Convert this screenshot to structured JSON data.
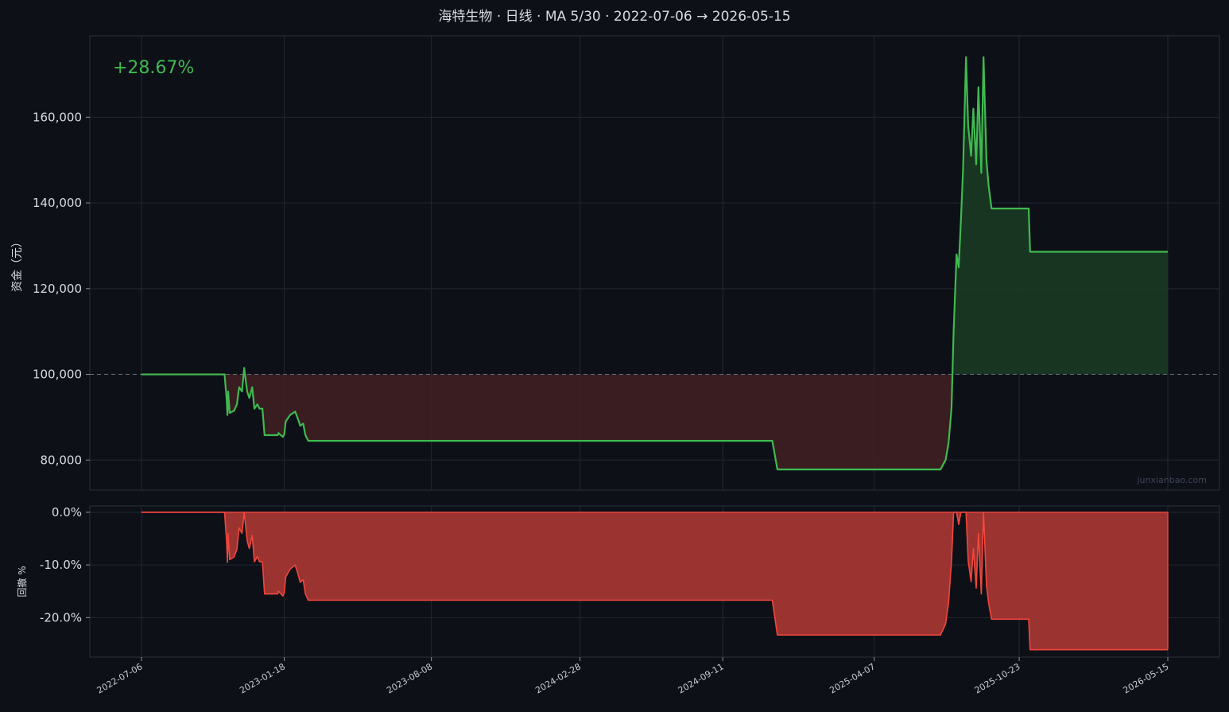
{
  "title": "海特生物 · 日线 · MA 5/30 · 2022-07-06 → 2026-05-15",
  "return_label": "+28.67%",
  "watermark": "junxianbao.com",
  "colors": {
    "background": "#0d1017",
    "equity_line": "#3fb950",
    "gain_fill": "#1a3a22",
    "loss_fill": "#3e1f22",
    "drawdown_line": "#f0473c",
    "drawdown_fill": "#9b3331",
    "return_text": "#3fb950"
  },
  "chart_data": [
    {
      "type": "area",
      "name": "equity",
      "ylabel": "资金（元）",
      "xlabel": "",
      "baseline": 100000,
      "ylim": [
        73000,
        179000
      ],
      "yticks": [
        80000,
        100000,
        120000,
        140000,
        160000
      ],
      "ytick_labels": [
        "80,000",
        "100,000",
        "120,000",
        "140,000",
        "160,000"
      ],
      "grid": true,
      "x": [
        "2022-07-06",
        "2022-10-28",
        "2022-10-31",
        "2022-11-01",
        "2022-11-02",
        "2022-11-04",
        "2022-11-10",
        "2022-11-14",
        "2022-11-17",
        "2022-11-21",
        "2022-11-24",
        "2022-11-28",
        "2022-12-01",
        "2022-12-05",
        "2022-12-08",
        "2022-12-12",
        "2022-12-15",
        "2022-12-19",
        "2022-12-22",
        "2023-01-09",
        "2023-01-10",
        "2023-01-16",
        "2023-01-18",
        "2023-01-20",
        "2023-01-26",
        "2023-02-02",
        "2023-02-06",
        "2023-02-09",
        "2023-02-13",
        "2023-02-16",
        "2023-02-20",
        "2023-02-23",
        "2023-02-27",
        "2023-03-01",
        "2023-03-02",
        "2024-11-18",
        "2024-11-25",
        "2025-07-07",
        "2025-07-10",
        "2025-07-14",
        "2025-07-18",
        "2025-07-22",
        "2025-07-25",
        "2025-07-29",
        "2025-08-01",
        "2025-08-04",
        "2025-08-07",
        "2025-08-11",
        "2025-08-14",
        "2025-08-18",
        "2025-08-21",
        "2025-08-25",
        "2025-08-28",
        "2025-09-01",
        "2025-09-04",
        "2025-09-08",
        "2025-09-11",
        "2025-09-15",
        "2025-09-18",
        "2025-09-22",
        "2025-09-25",
        "2025-09-29",
        "2025-10-09",
        "2025-10-13",
        "2025-10-17",
        "2025-11-05",
        "2025-11-07",
        "2026-05-15"
      ],
      "values": [
        100000,
        100000,
        94000,
        90500,
        96000,
        91000,
        91500,
        93000,
        97000,
        96000,
        101500,
        96000,
        94500,
        97000,
        92000,
        93000,
        92000,
        92000,
        85800,
        85800,
        86300,
        85400,
        86000,
        89000,
        90500,
        91300,
        89500,
        88000,
        88500,
        85800,
        84500,
        84500,
        84500,
        84500,
        84500,
        84500,
        77800,
        77800,
        78800,
        80000,
        84000,
        92000,
        110000,
        128000,
        125000,
        136000,
        148000,
        174000,
        158000,
        151000,
        162000,
        149000,
        167000,
        147000,
        174000,
        150000,
        144000,
        138700,
        138700,
        138700,
        138700,
        138700,
        138700,
        138700,
        138700,
        138700,
        128600,
        128600
      ]
    },
    {
      "type": "area",
      "name": "drawdown",
      "ylabel": "回撤 %",
      "xlabel": "",
      "ylim": [
        -27.5,
        1.2
      ],
      "yticks": [
        0,
        -10,
        -20
      ],
      "ytick_labels": [
        "0.0%",
        "-10.0%",
        "-20.0%"
      ],
      "grid": true,
      "x": [
        "2022-07-06",
        "2022-10-28",
        "2022-10-31",
        "2022-11-01",
        "2022-11-02",
        "2022-11-04",
        "2022-11-10",
        "2022-11-14",
        "2022-11-17",
        "2022-11-21",
        "2022-11-24",
        "2022-11-28",
        "2022-12-01",
        "2022-12-05",
        "2022-12-08",
        "2022-12-12",
        "2022-12-15",
        "2022-12-19",
        "2022-12-22",
        "2023-01-09",
        "2023-01-10",
        "2023-01-16",
        "2023-01-18",
        "2023-01-20",
        "2023-01-26",
        "2023-02-02",
        "2023-02-06",
        "2023-02-09",
        "2023-02-13",
        "2023-02-16",
        "2023-02-20",
        "2023-02-23",
        "2023-02-27",
        "2023-03-01",
        "2023-03-02",
        "2024-11-18",
        "2024-11-25",
        "2025-07-07",
        "2025-07-10",
        "2025-07-14",
        "2025-07-18",
        "2025-07-22",
        "2025-07-25",
        "2025-07-29",
        "2025-08-01",
        "2025-08-04",
        "2025-08-07",
        "2025-08-11",
        "2025-08-14",
        "2025-08-18",
        "2025-08-21",
        "2025-08-25",
        "2025-08-28",
        "2025-09-01",
        "2025-09-04",
        "2025-09-08",
        "2025-09-11",
        "2025-09-15",
        "2025-09-18",
        "2025-09-22",
        "2025-09-25",
        "2025-09-29",
        "2025-10-09",
        "2025-10-13",
        "2025-10-17",
        "2025-11-05",
        "2025-11-07",
        "2026-05-15"
      ],
      "values": [
        0,
        0,
        -6,
        -9.5,
        -4,
        -9,
        -8.5,
        -7,
        -3,
        -4,
        0,
        -5.4,
        -6.9,
        -4.4,
        -9.4,
        -8.4,
        -9.4,
        -9.4,
        -15.5,
        -15.5,
        -15,
        -15.9,
        -15.3,
        -12.3,
        -10.8,
        -10,
        -11.8,
        -13.3,
        -12.8,
        -15.5,
        -16.7,
        -16.7,
        -16.7,
        -16.7,
        -16.7,
        -16.7,
        -23.3,
        -23.3,
        -22.4,
        -21.2,
        -17.2,
        -9.4,
        0,
        0,
        -2.3,
        0,
        0,
        0,
        -9.2,
        -13.2,
        -6.9,
        -14.4,
        -4,
        -15.5,
        0,
        -13.8,
        -17.2,
        -20.3,
        -20.3,
        -20.3,
        -20.3,
        -20.3,
        -20.3,
        -20.3,
        -20.3,
        -20.3,
        -26.1,
        -26.1
      ]
    }
  ],
  "x_axis": {
    "ticks": [
      "2022-07-06",
      "2023-01-18",
      "2023-08-08",
      "2024-02-28",
      "2024-09-11",
      "2025-04-07",
      "2025-10-23",
      "2026-05-15"
    ]
  }
}
